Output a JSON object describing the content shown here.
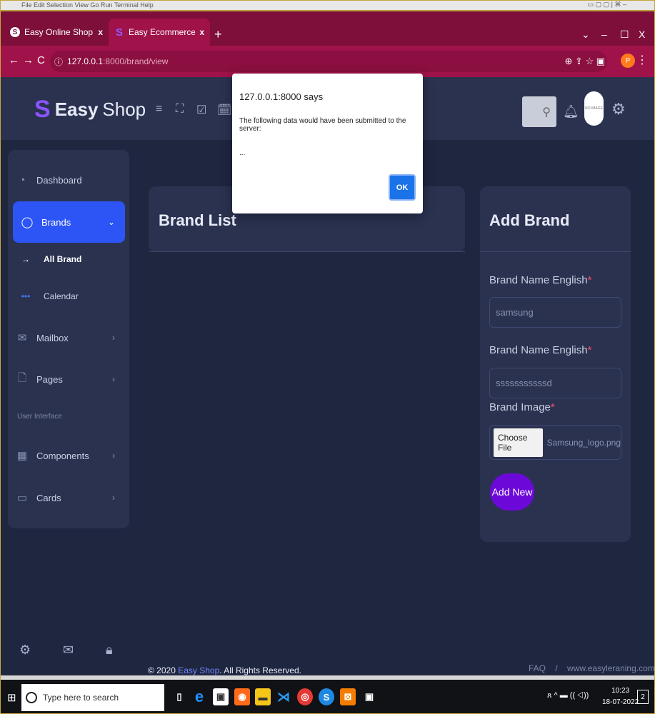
{
  "os_bar": {
    "text": "File  Edit  Selection  View  Go  Run  Terminal  Help",
    "controls": "▭  ▢  ▢  |  ⌘     –"
  },
  "browser": {
    "tabs": [
      {
        "title": "Easy Online Shop",
        "close": "x"
      },
      {
        "title": "Easy Ecommerce Admin - Dashb",
        "close": "x"
      }
    ],
    "new_tab": "+",
    "window_controls": {
      "chevron": "⌄",
      "minimize": "–",
      "maximize": "☐",
      "close": "X"
    },
    "nav": {
      "back": "←",
      "forward": "→",
      "reload": "C"
    },
    "url_host": "127.0.0.1",
    "url_path": ":8000/brand/view",
    "addr_icons": "⊕  ⇪  ☆   ▣",
    "profile_initial": "P",
    "menu": "⋮"
  },
  "header": {
    "logo_mark": "S",
    "logo_word1": "Easy",
    "logo_word2": "Shop",
    "avatar_text": "NO IMAGE"
  },
  "sidebar": {
    "items": [
      {
        "label": "Dashboard",
        "icon": "dashboard-icon"
      },
      {
        "label": "Brands",
        "icon": "chat-icon",
        "chevron": "⌄"
      },
      {
        "label": "Mailbox",
        "icon": "mail-icon",
        "chevron": "›"
      },
      {
        "label": "Pages",
        "icon": "page-icon",
        "chevron": "›"
      },
      {
        "label": "Components",
        "icon": "grid-icon",
        "chevron": "›"
      },
      {
        "label": "Cards",
        "icon": "card-icon",
        "chevron": "›"
      }
    ],
    "sub_items": [
      {
        "label": "All Brand",
        "icon": "→"
      },
      {
        "label": "Calendar",
        "icon": "•••"
      }
    ],
    "section_label": "User Interface"
  },
  "main": {
    "list_title": "Brand List",
    "add_title": "Add Brand",
    "form": {
      "label1": "Brand Name English",
      "value1": "samsung",
      "label2": "Brand Name English",
      "value2": "sssssssssssd",
      "label3": "Brand Image",
      "required_mark": "*",
      "file_button": "Choose File",
      "file_name": "Samsung_logo.png",
      "submit": "Add New"
    }
  },
  "footer": {
    "copy_prefix": "© 2020 ",
    "brand": "Easy Shop",
    "copy_suffix": ". All Rights Reserved.",
    "faq": "FAQ",
    "separator": "/",
    "site": "www.easyleraning.com"
  },
  "dialog": {
    "title": "127.0.0.1:8000 says",
    "message": "The following data would have been submitted to the server:",
    "body": "...",
    "ok": "OK"
  },
  "taskbar": {
    "search_placeholder": "Type here to search",
    "time": "10:23",
    "date": "18-07-2022",
    "notifications": "2",
    "tray": "ጸ  ^  ▬  ((  ◁))"
  },
  "colors": {
    "accent": "#2d55f5",
    "add_button": "#6c08d8",
    "tab_bar": "#7d0f3a",
    "page_bg": "#1f2640"
  }
}
